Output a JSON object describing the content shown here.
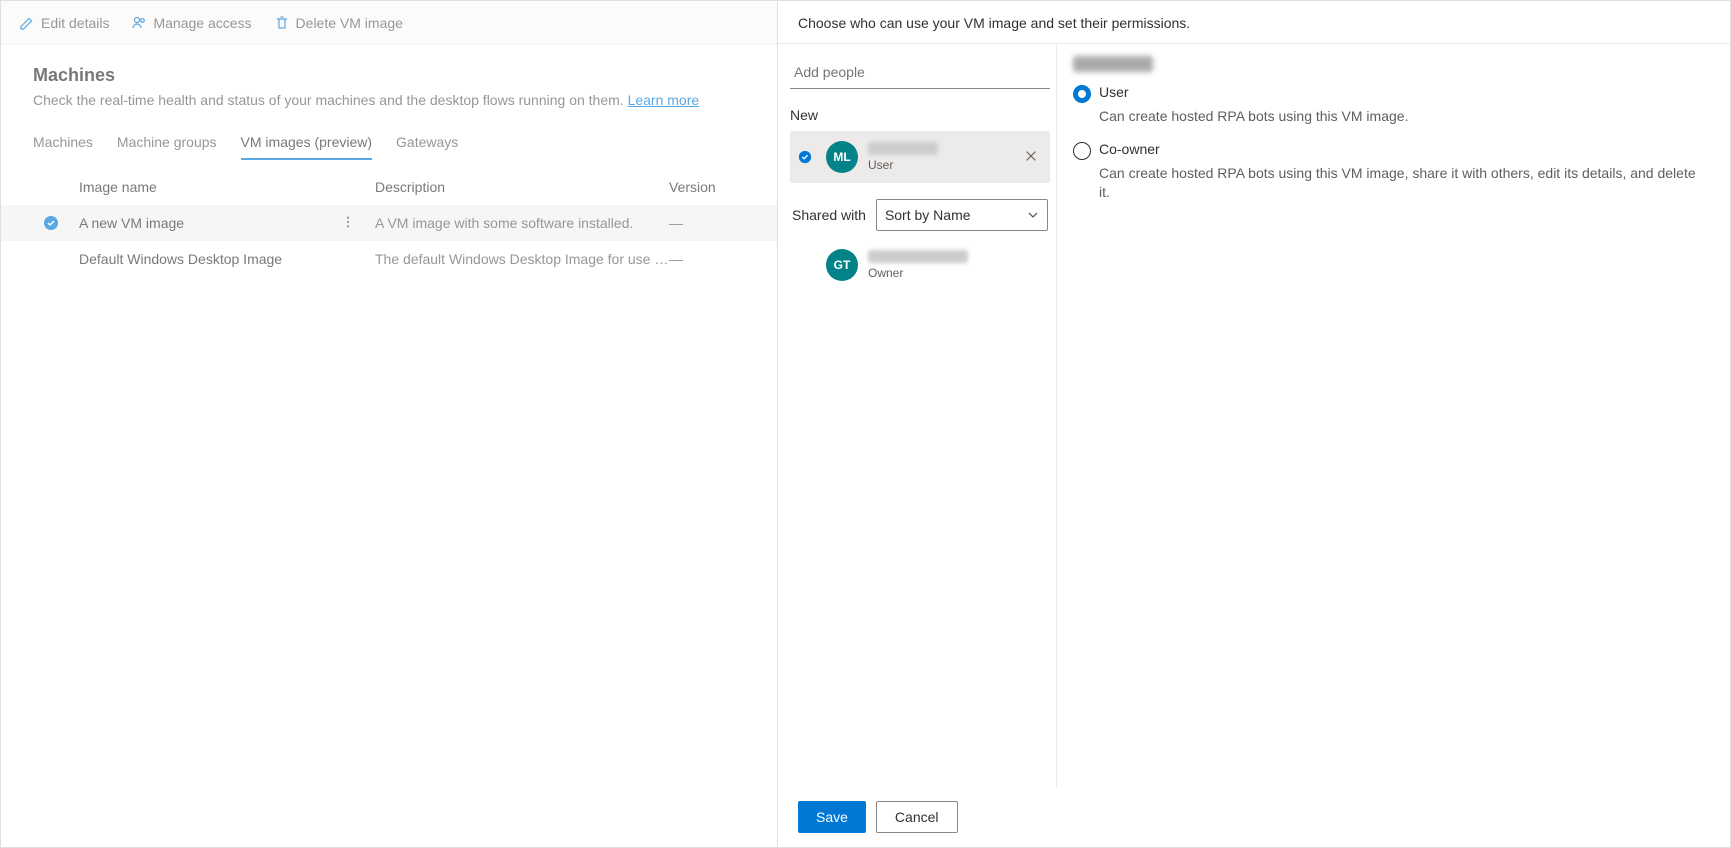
{
  "toolbar": {
    "edit_label": "Edit details",
    "manage_label": "Manage access",
    "delete_label": "Delete VM image"
  },
  "page": {
    "title": "Machines",
    "subtitle_pre": "Check the real-time health and status of your machines and the desktop flows running on them. ",
    "learn_more": "Learn more"
  },
  "tabs": [
    {
      "label": "Machines"
    },
    {
      "label": "Machine groups"
    },
    {
      "label": "VM images (preview)"
    },
    {
      "label": "Gateways"
    }
  ],
  "table": {
    "headers": {
      "name": "Image name",
      "desc": "Description",
      "ver": "Version"
    },
    "rows": [
      {
        "selected": true,
        "name": "A new VM image",
        "desc": "A VM image with some software installed.",
        "ver": "—"
      },
      {
        "selected": false,
        "name": "Default Windows Desktop Image",
        "desc": "The default Windows Desktop Image for use in the Product ...",
        "ver": "—"
      }
    ]
  },
  "panel": {
    "header": "Choose who can use your VM image and set their permissions.",
    "add_placeholder": "Add people",
    "new_label": "New",
    "new_person": {
      "initials": "ML",
      "role": "User"
    },
    "shared_label": "Shared with",
    "sort_value": "Sort by Name",
    "shared_person": {
      "initials": "GT",
      "role": "Owner"
    },
    "perm_user": {
      "label": "User",
      "desc": "Can create hosted RPA bots using this VM image."
    },
    "perm_coowner": {
      "label": "Co-owner",
      "desc": "Can create hosted RPA bots using this VM image, share it with others, edit its details, and delete it."
    },
    "save": "Save",
    "cancel": "Cancel"
  }
}
